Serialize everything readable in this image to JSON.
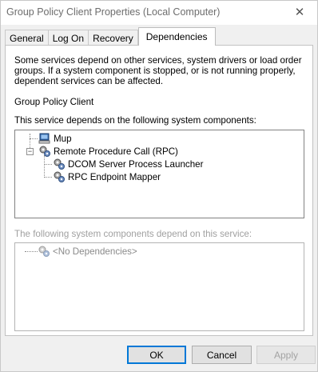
{
  "window": {
    "title": "Group Policy Client Properties (Local Computer)",
    "close_label": "✕"
  },
  "tabs": [
    {
      "label": "General",
      "active": false
    },
    {
      "label": "Log On",
      "active": false
    },
    {
      "label": "Recovery",
      "active": false
    },
    {
      "label": "Dependencies",
      "active": true
    }
  ],
  "panel": {
    "description": "Some services depend on other services, system drivers or load order groups. If a system component is stopped, or is not running properly, dependent services can be affected.",
    "service_name": "Group Policy Client",
    "depends_on_label": "This service depends on the following system components:",
    "depends_on_tree": [
      {
        "label": "Mup",
        "icon": "driver-icon",
        "level": 0,
        "expander": ""
      },
      {
        "label": "Remote Procedure Call (RPC)",
        "icon": "service-gear-icon",
        "level": 0,
        "expander": "−"
      },
      {
        "label": "DCOM Server Process Launcher",
        "icon": "service-gear-icon",
        "level": 1,
        "expander": ""
      },
      {
        "label": "RPC Endpoint Mapper",
        "icon": "service-gear-icon",
        "level": 1,
        "expander": ""
      }
    ],
    "dependents_label": "The following system components depend on this service:",
    "dependents_tree": [
      {
        "label": "<No Dependencies>",
        "icon": "service-gear-icon",
        "disabled": true
      }
    ]
  },
  "buttons": {
    "ok": "OK",
    "cancel": "Cancel",
    "apply": "Apply"
  },
  "colors": {
    "accent": "#0078d7",
    "window_bg": "#f0f0f0",
    "panel_bg": "#ffffff",
    "disabled_text": "#a0a0a0"
  }
}
